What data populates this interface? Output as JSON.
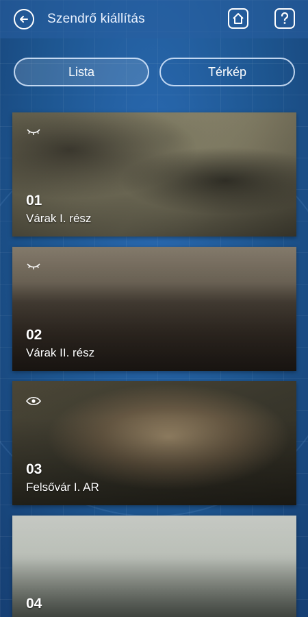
{
  "header": {
    "title": "Szendrő kiállítás",
    "back_icon": "arrow-left-icon",
    "home_icon": "home-icon",
    "help_icon": "question-mark-icon"
  },
  "tabs": {
    "list_label": "Lista",
    "map_label": "Térkép"
  },
  "cards": [
    {
      "number": "01",
      "label": "Várak I. rész",
      "status_icon": "eye-closed-icon"
    },
    {
      "number": "02",
      "label": "Várak II. rész",
      "status_icon": "eye-closed-icon"
    },
    {
      "number": "03",
      "label": "Felsővár I. AR",
      "status_icon": "eye-open-icon"
    },
    {
      "number": "04",
      "label": "",
      "status_icon": ""
    }
  ],
  "colors": {
    "background": "#1e5a9e",
    "header": "#285fa0",
    "text": "#ffffff"
  }
}
